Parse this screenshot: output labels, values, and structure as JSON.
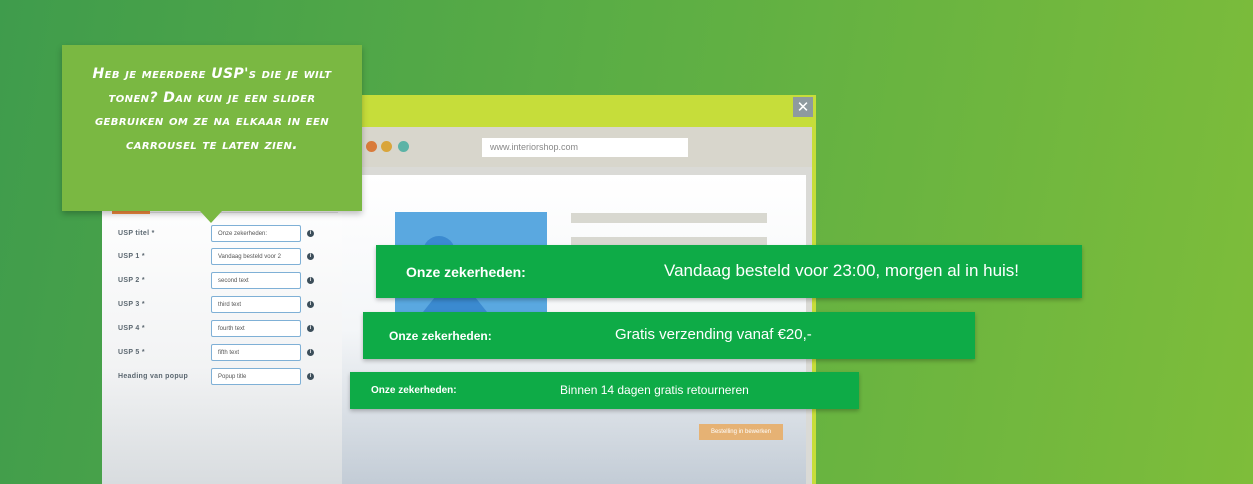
{
  "tooltip": {
    "text": "Heb je meerdere USP's die je wilt tonen? Dan kun je een slider gebruiken om ze na elkaar in een carrousel te laten zien."
  },
  "browser": {
    "url": "www.interiorshop.com",
    "close_icon": "close-icon",
    "cta_label": "Bestelling in bewerken"
  },
  "form": {
    "fields": [
      {
        "label": "USP titel *",
        "value": "Onze zekerheden:"
      },
      {
        "label": "USP 1 *",
        "value": "Vandaag besteld voor 2"
      },
      {
        "label": "USP 2 *",
        "value": "second text"
      },
      {
        "label": "USP 3 *",
        "value": "third text"
      },
      {
        "label": "USP 4 *",
        "value": "fourth text"
      },
      {
        "label": "USP 5 *",
        "value": "fifth text"
      },
      {
        "label": "Heading van popup",
        "value": "Popup title"
      }
    ],
    "info_icon": "info-icon"
  },
  "usp_bars": [
    {
      "heading": "Onze zekerheden:",
      "text": "Vandaag besteld voor 23:00, morgen al in huis!"
    },
    {
      "heading": "Onze zekerheden:",
      "text": "Gratis verzending vanaf €20,-"
    },
    {
      "heading": "Onze zekerheden:",
      "text": "Binnen 14 dagen gratis retourneren"
    }
  ],
  "colors": {
    "usp_green": "#0eab47",
    "tooltip_green": "#7ab842",
    "browser_lime": "#c6dd3a",
    "input_border": "#7fb0d6"
  }
}
